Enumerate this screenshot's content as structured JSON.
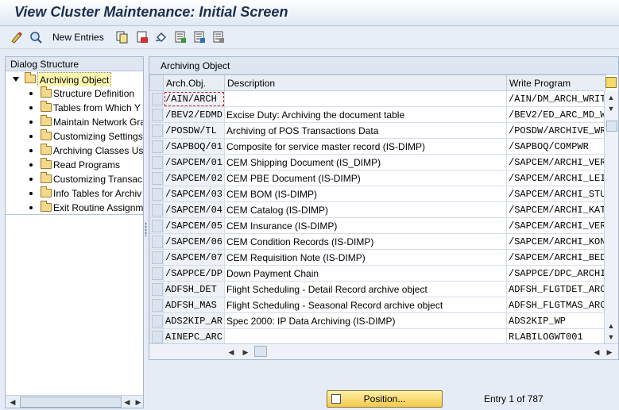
{
  "window": {
    "title": "View Cluster Maintenance: Initial Screen"
  },
  "toolbar": {
    "new_entries_label": "New Entries",
    "icons": [
      "change-display-icon",
      "glasses-icon",
      "copy-icon",
      "delete-icon",
      "undo-icon",
      "select-all-icon",
      "select-block-icon",
      "deselect-all-icon"
    ]
  },
  "dialog": {
    "header": "Dialog Structure",
    "root": "Archiving Object",
    "items": [
      "Structure Definition",
      "Tables from Which Y",
      "Maintain Network Gra",
      "Customizing Settings",
      "Archiving Classes Us",
      "Read Programs",
      "Customizing Transac",
      "Info Tables for Archiv",
      "Exit Routine Assignm"
    ]
  },
  "table": {
    "title": "Archiving Object",
    "columns": [
      "Arch.Obj.",
      "Description",
      "Write Program"
    ],
    "rows": [
      [
        "/AIN/ARCH",
        "",
        "/AIN/DM_ARCH_WRIT"
      ],
      [
        "/BEV2/EDMD",
        "Excise Duty: Archiving the document table",
        "/BEV2/ED_ARC_MD_W"
      ],
      [
        "/POSDW/TL",
        "Archiving of POS Transactions Data",
        "/POSDW/ARCHIVE_WR"
      ],
      [
        "/SAPBOQ/01",
        "Composite for service master record (IS-DIMP)",
        "/SAPBOQ/COMPWR"
      ],
      [
        "/SAPCEM/01",
        "CEM Shipping Document (IS_DIMP)",
        "/SAPCEM/ARCHI_VER"
      ],
      [
        "/SAPCEM/02",
        "CEM PBE Document (IS-DIMP)",
        "/SAPCEM/ARCHI_LEI"
      ],
      [
        "/SAPCEM/03",
        "CEM BOM (IS-DIMP)",
        "/SAPCEM/ARCHI_STU"
      ],
      [
        "/SAPCEM/04",
        "CEM Catalog (IS-DIMP)",
        "/SAPCEM/ARCHI_KAT"
      ],
      [
        "/SAPCEM/05",
        "CEM Insurance (IS-DIMP)",
        "/SAPCEM/ARCHI_VER"
      ],
      [
        "/SAPCEM/06",
        "CEM Condition Records (IS-DIMP)",
        "/SAPCEM/ARCHI_KON"
      ],
      [
        "/SAPCEM/07",
        "CEM Requisition Note (IS-DIMP)",
        "/SAPCEM/ARCHI_BED"
      ],
      [
        "/SAPPCE/DP",
        "Down Payment Chain",
        "/SAPPCE/DPC_ARCHI"
      ],
      [
        "ADFSH_DET",
        "Flight Scheduling - Detail Record archive object",
        "ADFSH_FLGTDET_ARC"
      ],
      [
        "ADFSH_MAS",
        "Flight Scheduling - Seasonal Record archive object",
        "ADFSH_FLGTMAS_ARC"
      ],
      [
        "ADS2KIP_AR",
        "Spec 2000: IP Data Archiving (IS-DIMP)",
        "ADS2KIP_WP"
      ],
      [
        "AINEPC_ARC",
        "",
        "RLABILOGWT001"
      ]
    ]
  },
  "footer": {
    "position_label": "Position...",
    "entry_text": "Entry 1 of 787"
  }
}
